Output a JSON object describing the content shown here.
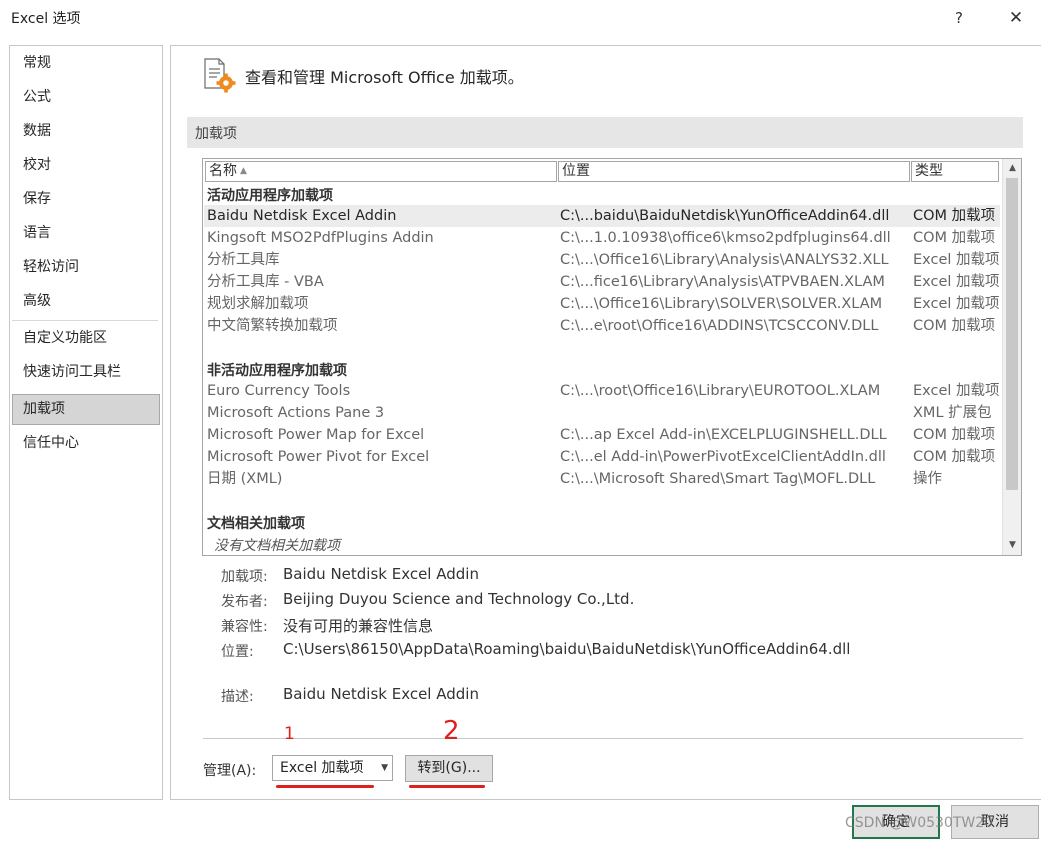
{
  "window": {
    "title": "Excel 选项",
    "help": "?",
    "close": "✕"
  },
  "nav": {
    "items": [
      "常规",
      "公式",
      "数据",
      "校对",
      "保存",
      "语言",
      "轻松访问",
      "高级",
      "自定义功能区",
      "快速访问工具栏",
      "加载项",
      "信任中心"
    ],
    "active": "加载项"
  },
  "header": {
    "text": "查看和管理 Microsoft Office 加载项。",
    "icon": "addin-gear-icon"
  },
  "section": {
    "title": "加载项"
  },
  "table": {
    "columns": [
      "名称",
      "位置",
      "类型"
    ],
    "groups": [
      {
        "title": "活动应用程序加载项",
        "rows": [
          [
            "Baidu Netdisk Excel Addin",
            "C:\\...baidu\\BaiduNetdisk\\YunOfficeAddin64.dll",
            "COM 加载项"
          ],
          [
            "Kingsoft MSO2PdfPlugins Addin",
            "C:\\...1.0.10938\\office6\\kmso2pdfplugins64.dll",
            "COM 加载项"
          ],
          [
            "分析工具库",
            "C:\\...\\Office16\\Library\\Analysis\\ANALYS32.XLL",
            "Excel 加载项"
          ],
          [
            "分析工具库 - VBA",
            "C:\\...fice16\\Library\\Analysis\\ATPVBAEN.XLAM",
            "Excel 加载项"
          ],
          [
            "规划求解加载项",
            "C:\\...\\Office16\\Library\\SOLVER\\SOLVER.XLAM",
            "Excel 加载项"
          ],
          [
            "中文简繁转换加载项",
            "C:\\...e\\root\\Office16\\ADDINS\\TCSCCONV.DLL",
            "COM 加载项"
          ]
        ]
      },
      {
        "title": "非活动应用程序加载项",
        "rows": [
          [
            "Euro Currency Tools",
            "C:\\...\\root\\Office16\\Library\\EUROTOOL.XLAM",
            "Excel 加载项"
          ],
          [
            "Microsoft Actions Pane 3",
            "",
            "XML 扩展包"
          ],
          [
            "Microsoft Power Map for Excel",
            "C:\\...ap Excel Add-in\\EXCELPLUGINSHELL.DLL",
            "COM 加载项"
          ],
          [
            "Microsoft Power Pivot for Excel",
            "C:\\...el Add-in\\PowerPivotExcelClientAddIn.dll",
            "COM 加载项"
          ],
          [
            "日期 (XML)",
            "C:\\...\\Microsoft Shared\\Smart Tag\\MOFL.DLL",
            "操作"
          ]
        ]
      },
      {
        "title": "文档相关加载项",
        "empty": "没有文档相关加载项"
      }
    ]
  },
  "details": {
    "addin_label": "加载项:",
    "addin": "Baidu Netdisk Excel Addin",
    "publisher_label": "发布者:",
    "publisher": "Beijing Duyou Science and Technology Co.,Ltd.",
    "compat_label": "兼容性:",
    "compat": "没有可用的兼容性信息",
    "location_label": "位置:",
    "location": "C:\\Users\\86150\\AppData\\Roaming\\baidu\\BaiduNetdisk\\YunOfficeAddin64.dll",
    "desc_label": "描述:",
    "desc": "Baidu Netdisk Excel Addin"
  },
  "manage": {
    "label": "管理(A):",
    "selected": "Excel 加载项",
    "go": "转到(G)..."
  },
  "annotations": {
    "one": "1",
    "two": "2",
    "color": "#e0201c"
  },
  "footer": {
    "ok": "确定",
    "cancel": "取消",
    "watermark": "CSDN @W0530TW20"
  }
}
